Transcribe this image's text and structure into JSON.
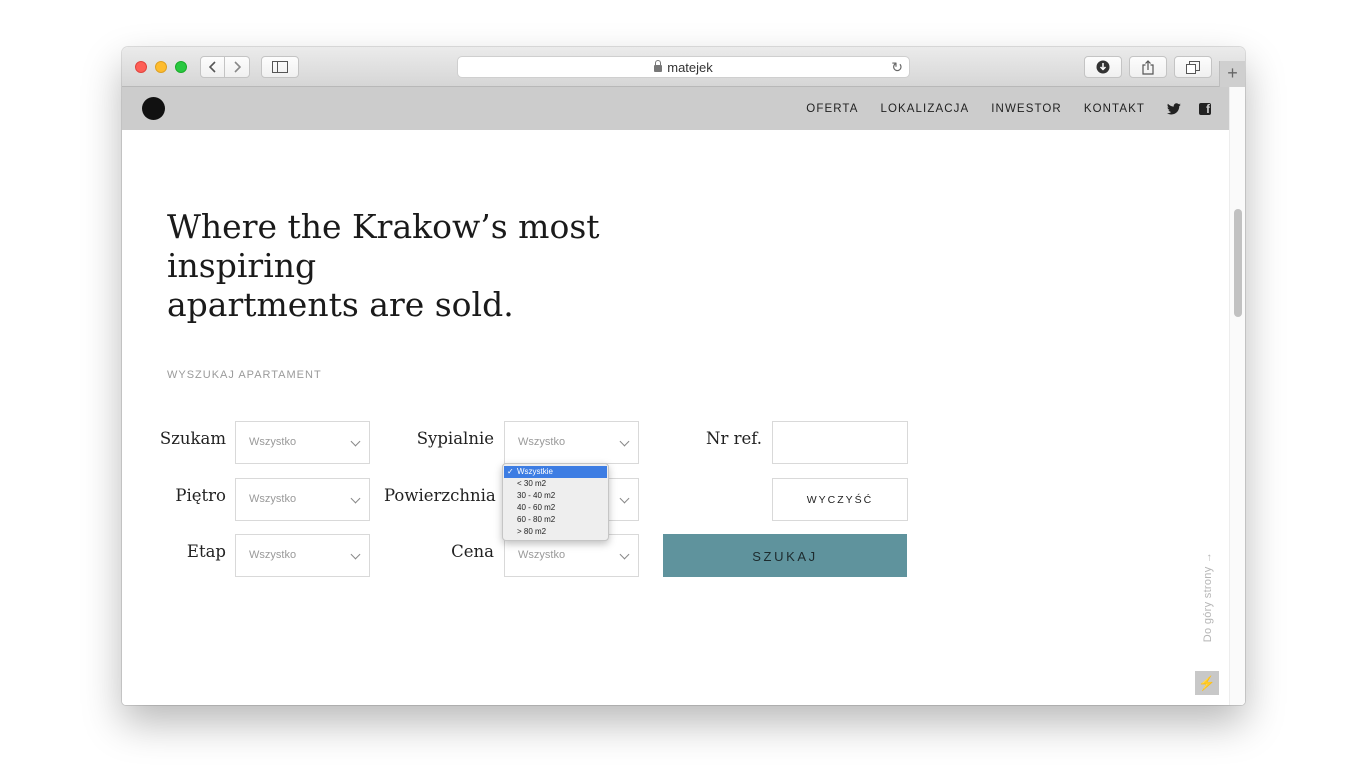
{
  "browser": {
    "url": "matejek",
    "new_tab_label": "+"
  },
  "site": {
    "nav": [
      "OFERTA",
      "LOKALIZACJA",
      "INWESTOR",
      "KONTAKT"
    ]
  },
  "hero": {
    "title_line1": "Where the Krakow’s most inspiring",
    "title_line2": "apartments are sold."
  },
  "search": {
    "section_label": "WYSZUKAJ APARTAMENT",
    "labels": {
      "szukam": "Szukam",
      "sypialnie": "Sypialnie",
      "nr_ref": "Nr ref.",
      "pietro": "Piętro",
      "powierzchnia": "Powierzchnia",
      "etap": "Etap",
      "cena": "Cena"
    },
    "select_value": "Wszystko",
    "clear_button": "WYCZYŚĆ",
    "search_button": "SZUKAJ",
    "dropdown_options": [
      "Wszystkie",
      "< 30 m2",
      "30 - 40 m2",
      "40 - 60 m2",
      "60 - 80 m2",
      "> 80 m2"
    ],
    "dropdown_selected": "Wszystkie"
  },
  "scroll_top_label": "Do góry strony →",
  "accent_color": "#5f939d"
}
